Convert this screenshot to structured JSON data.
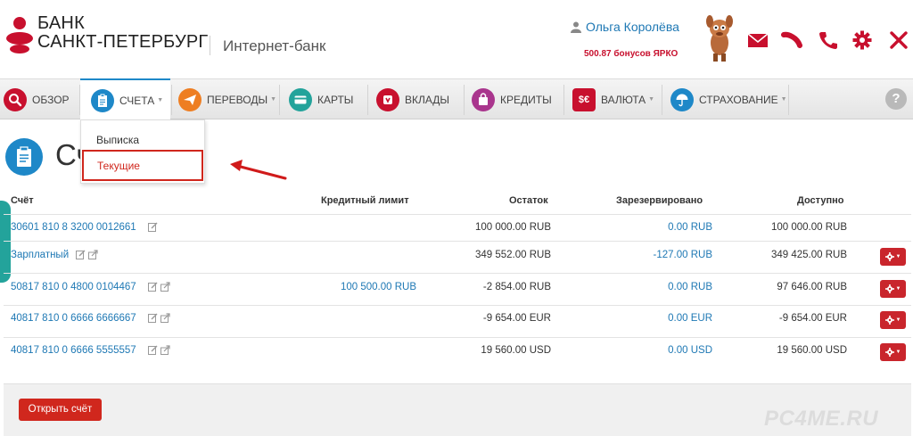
{
  "header": {
    "logo_line1": "БАНК",
    "logo_line2": "САНКТ-ПЕТЕРБУРГ",
    "subtitle": "Интернет-банк",
    "user_name": "Ольга Королёва",
    "bonus": "500.87 бонусов ЯРКО",
    "icons": [
      "mail-icon",
      "sausage-icon",
      "phone-icon",
      "gear-icon",
      "close-icon"
    ]
  },
  "nav": {
    "items": [
      {
        "label": "ОБЗОР",
        "icon": "search-icon",
        "color": "#c8102e"
      },
      {
        "label": "СЧЕТА",
        "icon": "clipboard-icon",
        "color": "#1e88c8"
      },
      {
        "label": "ПЕРЕВОДЫ",
        "icon": "paper-plane-icon",
        "color": "#ee7e22"
      },
      {
        "label": "КАРТЫ",
        "icon": "card-icon",
        "color": "#23a39b"
      },
      {
        "label": "ВКЛАДЫ",
        "icon": "piggy-icon",
        "color": "#c8102e"
      },
      {
        "label": "КРЕДИТЫ",
        "icon": "bag-icon",
        "color": "#a9358d"
      },
      {
        "label": "ВАЛЮТА",
        "icon": "currency-icon",
        "color": "#c8102e"
      },
      {
        "label": "СТРАХОВАНИЕ",
        "icon": "umbrella-icon",
        "color": "#1e88c8"
      }
    ],
    "help": "?"
  },
  "dropdown": {
    "items": [
      "Выписка",
      "Текущие"
    ]
  },
  "page": {
    "title": "Сч"
  },
  "table": {
    "headers": [
      "Счёт",
      "Кредитный лимит",
      "Остаток",
      "Зарезервировано",
      "Доступно"
    ],
    "rows": [
      {
        "account": "30601 810 8 3200 0012661",
        "credit": "",
        "balance": "100 000.00 RUB",
        "reserved": "0.00 RUB",
        "available": "100 000.00 RUB"
      },
      {
        "account": "Зарплатный",
        "credit": "",
        "balance": "349 552.00 RUB",
        "reserved": "-127.00 RUB",
        "available": "349 425.00 RUB"
      },
      {
        "account": "50817 810 0 4800 0104467",
        "credit": "100 500.00 RUB",
        "balance": "-2 854.00 RUB",
        "reserved": "0.00 RUB",
        "available": "97 646.00 RUB"
      },
      {
        "account": "40817 810 0 6666 6666667",
        "credit": "",
        "balance": "-9 654.00 EUR",
        "reserved": "0.00 EUR",
        "available": "-9 654.00 EUR"
      },
      {
        "account": "40817 810 0 6666 5555557",
        "credit": "",
        "balance": "19 560.00 USD",
        "reserved": "0.00 USD",
        "available": "19 560.00 USD"
      }
    ]
  },
  "footer": {
    "open_button": "Открыть счёт",
    "watermark": "PC4ME.RU"
  },
  "colors": {
    "brand_red": "#c8102e",
    "link_blue": "#1e78b4",
    "accent_blue": "#1e88c8",
    "button_red": "#d0271d"
  }
}
